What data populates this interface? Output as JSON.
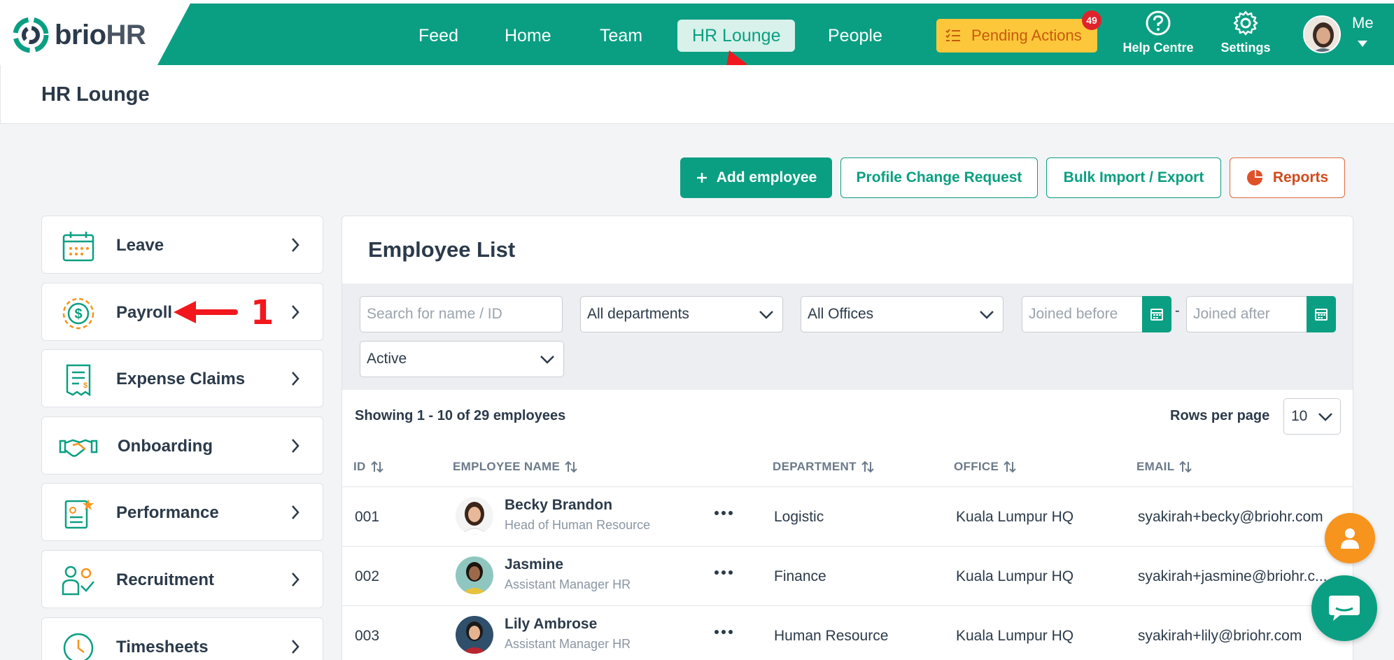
{
  "brand": {
    "logo_main": "brio",
    "logo_accent": "HR",
    "primary_color": "#0a9f82",
    "accent_orange": "#f7941d"
  },
  "nav": {
    "items": [
      {
        "label": "Feed"
      },
      {
        "label": "Home"
      },
      {
        "label": "Team"
      },
      {
        "label": "HR Lounge",
        "active": true
      },
      {
        "label": "People"
      }
    ],
    "pending_actions": {
      "label": "Pending Actions",
      "count": "49"
    },
    "help": "Help Centre",
    "settings": "Settings",
    "me": "Me"
  },
  "page": {
    "title": "HR Lounge"
  },
  "actions": {
    "add_employee": "Add employee",
    "profile_change": "Profile Change Request",
    "bulk_import": "Bulk Import / Export",
    "reports": "Reports"
  },
  "sidebar": {
    "items": [
      {
        "label": "Leave",
        "icon": "calendar-icon"
      },
      {
        "label": "Payroll",
        "icon": "dollar-coin-icon"
      },
      {
        "label": "Expense Claims",
        "icon": "receipt-icon"
      },
      {
        "label": "Onboarding",
        "icon": "handshake-icon"
      },
      {
        "label": "Performance",
        "icon": "clipboard-star-icon"
      },
      {
        "label": "Recruitment",
        "icon": "people-check-icon"
      },
      {
        "label": "Timesheets",
        "icon": "clock-icon"
      }
    ]
  },
  "employee_list": {
    "title": "Employee List",
    "filters": {
      "search_placeholder": "Search for name / ID",
      "department": "All departments",
      "office": "All Offices",
      "joined_before_placeholder": "Joined before",
      "joined_after_placeholder": "Joined after",
      "separator": "-",
      "status": "Active"
    },
    "showing": "Showing 1 - 10 of 29 employees",
    "rows_per_page_label": "Rows per page",
    "rows_per_page": "10",
    "columns": [
      "ID",
      "EMPLOYEE NAME",
      "DEPARTMENT",
      "OFFICE",
      "EMAIL"
    ],
    "rows": [
      {
        "id": "001",
        "name": "Becky Brandon",
        "title": "Head of Human Resource",
        "department": "Logistic",
        "office": "Kuala Lumpur HQ",
        "email": "syakirah+becky@briohr.com"
      },
      {
        "id": "002",
        "name": "Jasmine",
        "title": "Assistant Manager HR",
        "department": "Finance",
        "office": "Kuala Lumpur HQ",
        "email": "syakirah+jasmine@briohr.c..."
      },
      {
        "id": "003",
        "name": "Lily Ambrose",
        "title": "Assistant Manager HR",
        "department": "Human Resource",
        "office": "Kuala Lumpur HQ",
        "email": "syakirah+lily@briohr.com"
      }
    ]
  },
  "annotations": {
    "step_number": "1"
  }
}
